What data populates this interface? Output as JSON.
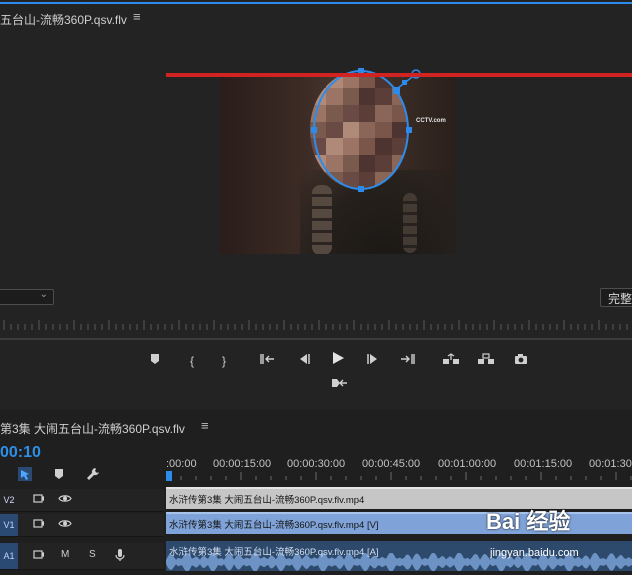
{
  "monitor": {
    "title": "五台山-流畅360P.qsv.flv",
    "menu_icon": "≡",
    "video_watermark": "CCTV.com",
    "quality_label": "完整"
  },
  "timeline": {
    "sequence_title": "第3集 大闹五台山-流畅360P.qsv.flv",
    "menu_icon": "≡",
    "timecode": "00:10",
    "ruler_labels": [
      ":00:00",
      "00:00:15:00",
      "00:00:30:00",
      "00:00:45:00",
      "00:01:00:00",
      "00:01:15:00",
      "00:01:30"
    ],
    "tracks": [
      {
        "id": "V2",
        "clip": "水浒传第3集 大闹五台山-流畅360P.qsv.flv.mp4"
      },
      {
        "id": "V1",
        "clip": "水浒传第3集 大闹五台山-流畅360P.qsv.flv.mp4 [V]"
      },
      {
        "id": "A1",
        "clip": "水浒传第3集 大闹五台山-流畅360P.qsv.flv.mp4 [A]",
        "mute_label": "M",
        "solo_label": "S"
      }
    ]
  },
  "watermark": {
    "brand": "Bai 经验",
    "url": "jingyan.baidu.com"
  },
  "icons": {
    "mask_color": "#2d8ceb",
    "accent": "#2e8fe6",
    "work_area": "#d22323"
  }
}
